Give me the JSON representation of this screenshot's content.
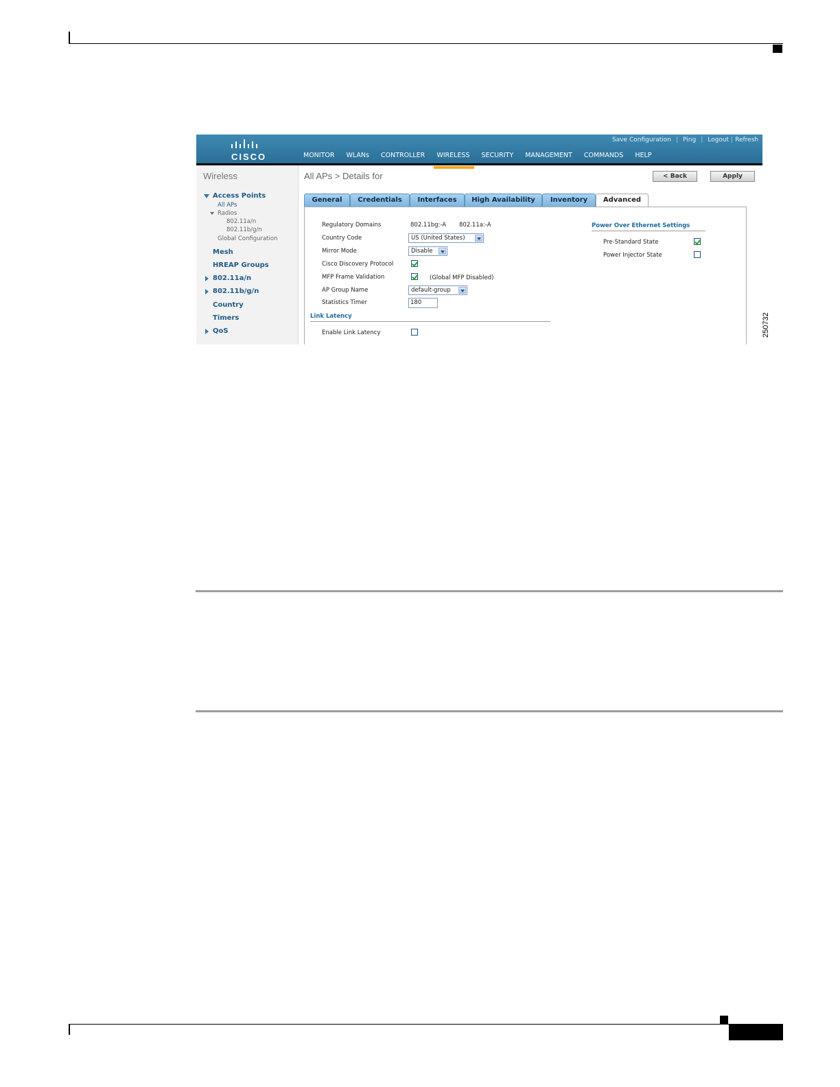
{
  "figure_number": "250732",
  "topbar": {
    "logo_text": "CISCO",
    "utility_links": [
      "Save Configuration",
      "Ping",
      "Logout",
      "Refresh"
    ],
    "nav": [
      "MONITOR",
      "WLANs",
      "CONTROLLER",
      "WIRELESS",
      "SECURITY",
      "MANAGEMENT",
      "COMMANDS",
      "HELP"
    ],
    "active_nav": "WIRELESS"
  },
  "sidebar": {
    "title": "Wireless",
    "access_points": "Access Points",
    "all_aps": "All APs",
    "radios": "Radios",
    "radio_a": "802.11a/n",
    "radio_bg": "802.11b/g/n",
    "global_config": "Global Configuration",
    "mesh": "Mesh",
    "hreap": "HREAP Groups",
    "band_a": "802.11a/n",
    "band_bg": "802.11b/g/n",
    "country": "Country",
    "timers": "Timers",
    "qos": "QoS"
  },
  "main": {
    "title": "All APs > Details for",
    "back_label": "< Back",
    "apply_label": "Apply",
    "tabs": [
      "General",
      "Credentials",
      "Interfaces",
      "High Availability",
      "Inventory",
      "Advanced"
    ],
    "active_tab": "Advanced"
  },
  "form": {
    "regulatory_domains_label": "Regulatory Domains",
    "regulatory_bg": "802.11bg:-A",
    "regulatory_a": "802.11a:-A",
    "country_code_label": "Country Code",
    "country_code_value": "US (United States)",
    "mirror_mode_label": "Mirror Mode",
    "mirror_mode_value": "Disable",
    "cdp_label": "Cisco Discovery Protocol",
    "cdp_checked": true,
    "mfp_label": "MFP Frame Validation",
    "mfp_checked": true,
    "mfp_note": "(Global MFP Disabled)",
    "ap_group_label": "AP Group Name",
    "ap_group_value": "default-group",
    "stats_timer_label": "Statistics Timer",
    "stats_timer_value": "180",
    "link_latency_section": "Link Latency",
    "enable_link_latency_label": "Enable Link Latency",
    "enable_link_latency_checked": false
  },
  "poe": {
    "section": "Power Over Ethernet Settings",
    "pre_standard_label": "Pre-Standard State",
    "pre_standard_checked": true,
    "injector_label": "Power Injector State",
    "injector_checked": false
  }
}
